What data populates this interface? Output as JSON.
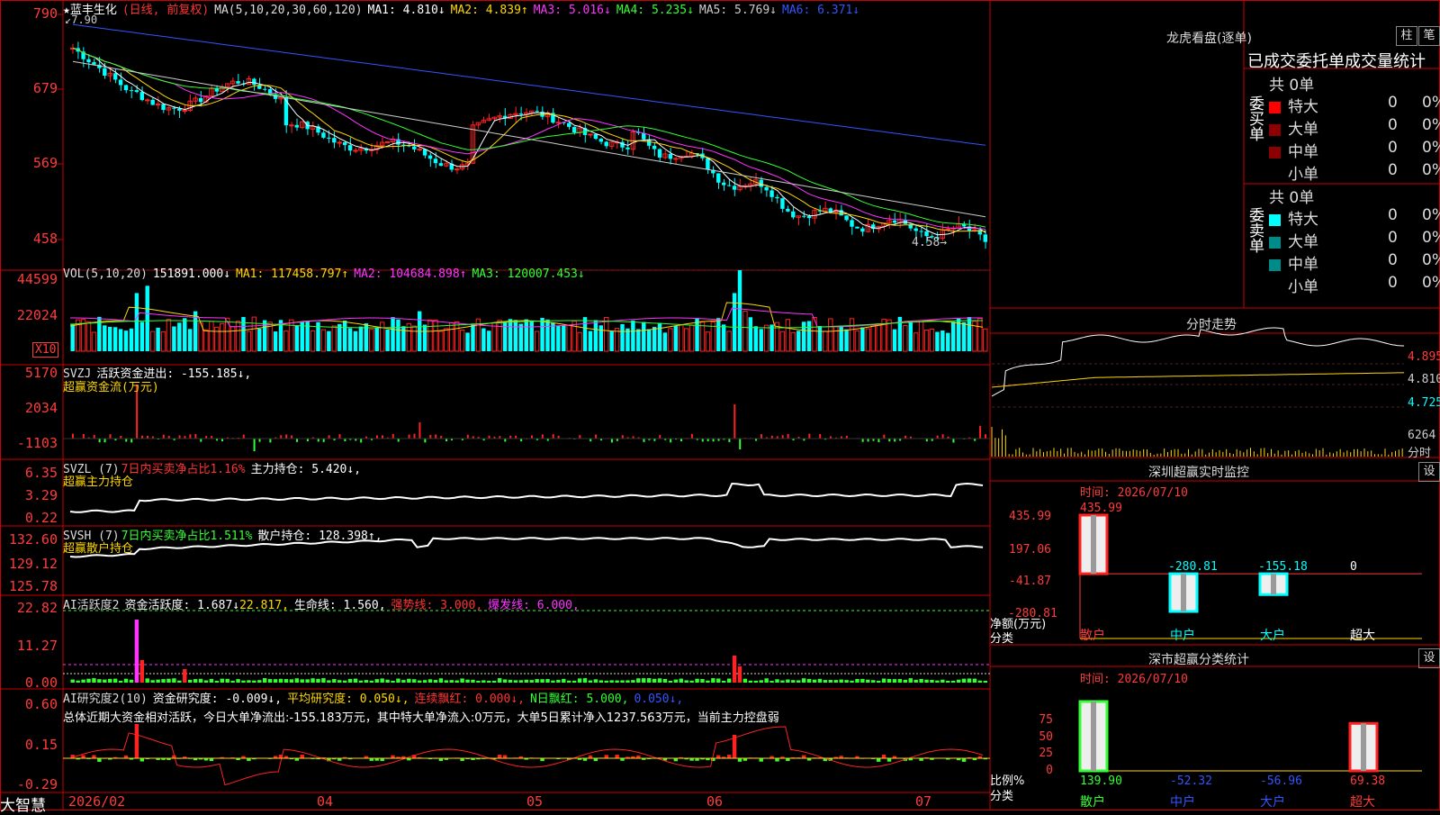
{
  "stock": {
    "star": "★",
    "name": "蓝丰生化",
    "period": "(日线, 前复权)",
    "ma_label": "MA(5,10,20,30,60,120)",
    "ma1": "MA1: 4.810↓",
    "ma2": "MA2: 4.839↑",
    "ma3": "MA3: 5.016↓",
    "ma4": "MA4: 5.235↓",
    "ma5": "MA5: 5.769↓",
    "ma6": "MA6: 6.371↓",
    "high_mark": "7.90",
    "low_mark": "4.58→"
  },
  "price_axis": [
    "790",
    "679",
    "569",
    "458"
  ],
  "vol": {
    "label": "VOL(5,10,20)",
    "value": "151891.000↓",
    "ma1": "MA1: 117458.797↑",
    "ma2": "MA2: 104684.898↑",
    "ma3": "MA3: 120007.453↓",
    "axis": [
      "44599",
      "22024"
    ],
    "unit": "X10"
  },
  "svzj": {
    "label": "SVZJ",
    "text": "活跃资金进出: -155.185↓,",
    "sub": "超赢资金流(万元)",
    "axis": [
      "5170",
      "2034",
      "-1103"
    ]
  },
  "svzl": {
    "label": "SVZL (7)",
    "text1": "7日内买卖净占比1.16%",
    "text2": "主力持仓: 5.420↓,",
    "sub": "超赢主力持仓",
    "axis": [
      "6.35",
      "3.29",
      "0.22"
    ]
  },
  "svsh": {
    "label": "SVSH (7)",
    "text1": "7日内买卖净占比1.511%",
    "text2": "散户持仓: 128.398↑,",
    "sub": "超赢散户持仓",
    "axis": [
      "132.60",
      "129.12",
      "125.78"
    ]
  },
  "ai1": {
    "label": "AI活跃度2",
    "t1": "资金活跃度: 1.687↓",
    "t2": "22.817,",
    "t3": "生命线: 1.560,",
    "t4": "强势线: 3.000,",
    "t5": "爆发线: 6.000,",
    "axis": [
      "22.82",
      "11.27",
      "0.00"
    ]
  },
  "ai2": {
    "label": "AI研究度2(10)",
    "t1": "资金研究度: -0.009↓,",
    "t2": "平均研究度: 0.050↓,",
    "t3": "连续飘红: 0.000↓,",
    "t4": "N日飘红: 5.000,",
    "t5": "0.050↓,",
    "summary": "总体近期大资金相对活跃，今日大单净流出:-155.183万元，其中特大单净流入:0万元，大单5日累计净入1237.563万元，当前主力控盘弱",
    "axis": [
      "0.60",
      "0.15",
      "-0.29"
    ]
  },
  "xaxis": [
    "2026/02",
    "04",
    "05",
    "06",
    "07"
  ],
  "footer_logo": "大智慧",
  "lhb": {
    "title": "龙虎看盘(逐单)",
    "btn1": "柱",
    "btn2": "笔",
    "tabs": "已成交委托单成交量统计",
    "buy_label": "委买单",
    "sell_label": "委卖单",
    "buy_total": "共 0单",
    "sell_total": "共 0单",
    "rows": [
      "特大",
      "大单",
      "中单",
      "小单"
    ],
    "buy_colors": [
      "#ff0000",
      "#8b0000",
      "#8b0000",
      "#000000"
    ],
    "sell_colors": [
      "#00ffff",
      "#008b8b",
      "#008b8b",
      "#000000"
    ],
    "count": "0",
    "pct": "0%"
  },
  "fenshi": {
    "title": "分时走势",
    "axis": [
      "4.895",
      "4.810",
      "4.725"
    ],
    "vol": "6264",
    "vol_unit": "分时"
  },
  "sz_monitor": {
    "title": "深圳超赢实时监控",
    "settings": "设",
    "time": "时间: 2026/07/10",
    "axis": [
      "435.99",
      "197.06",
      "-41.87",
      "-280.81"
    ],
    "ylabel": "净额(万元)",
    "xlabel": "分类",
    "cats": [
      "散户",
      "中户",
      "大户",
      "超大"
    ]
  },
  "sz_class": {
    "title": "深市超赢分类统计",
    "settings": "设",
    "time": "时间: 2026/07/10",
    "axis": [
      "75",
      "50",
      "25",
      "0"
    ],
    "ylabel": "比例%",
    "xlabel": "分类",
    "cats": [
      "散户",
      "中户",
      "大户",
      "超大"
    ]
  },
  "chart_data": [
    {
      "type": "bar",
      "title": "深圳超赢实时监控",
      "ylabel": "净额(万元)",
      "xlabel": "分类",
      "categories": [
        "散户",
        "中户",
        "大户",
        "超大"
      ],
      "values": [
        435.99,
        -280.81,
        -155.18,
        0
      ],
      "labels": [
        "435.99",
        "-280.81",
        "-155.18",
        "0"
      ],
      "ylim": [
        -280.81,
        435.99
      ]
    },
    {
      "type": "bar",
      "title": "深市超赢分类统计",
      "ylabel": "比例%",
      "xlabel": "分类",
      "categories": [
        "散户",
        "中户",
        "大户",
        "超大"
      ],
      "values": [
        139.9,
        -52.32,
        -56.96,
        69.38
      ],
      "labels": [
        "139.90",
        "-52.32",
        "-56.96",
        "69.38"
      ],
      "ylim": [
        0,
        75
      ]
    }
  ]
}
